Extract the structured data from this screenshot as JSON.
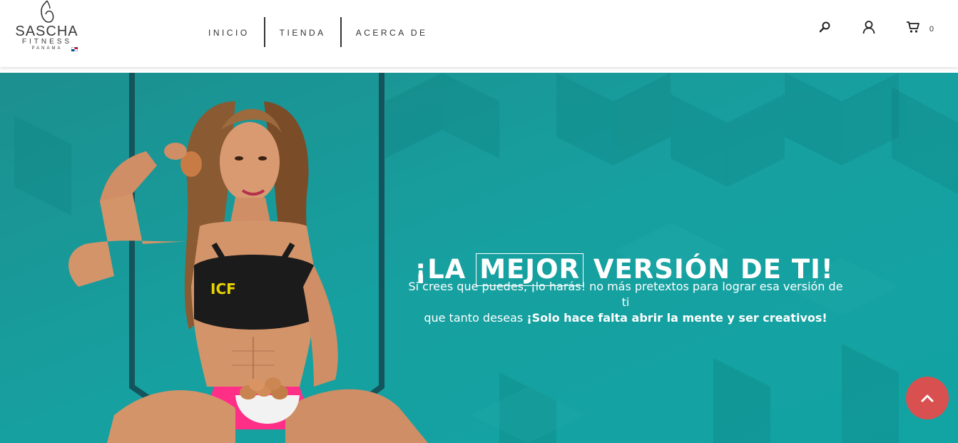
{
  "brand": {
    "name": "SASCHA",
    "tagline": "FITNESS",
    "region": "PANAMA"
  },
  "nav": {
    "items": [
      {
        "label": "INICIO"
      },
      {
        "label": "TIENDA"
      },
      {
        "label": "ACERCA DE"
      }
    ]
  },
  "header_icons": {
    "search": "search-icon",
    "account": "user-icon",
    "cart": "cart-icon",
    "cart_count": "0"
  },
  "hero": {
    "title_before": "¡LA ",
    "title_boxed": "MEJOR",
    "title_after": " VERSIÓN DE TI!",
    "text_line1": "Si crees que puedes, ¡lo harás! no más pretextos para lograr esa versión de ti",
    "text_line2_normal": "que tanto deseas ",
    "text_line2_bold": "¡Solo hace falta abrir la mente y ser creativos!",
    "background_color": "#199a9a"
  },
  "back_to_top": {
    "icon": "chevron-up-icon",
    "color": "#d95050"
  }
}
